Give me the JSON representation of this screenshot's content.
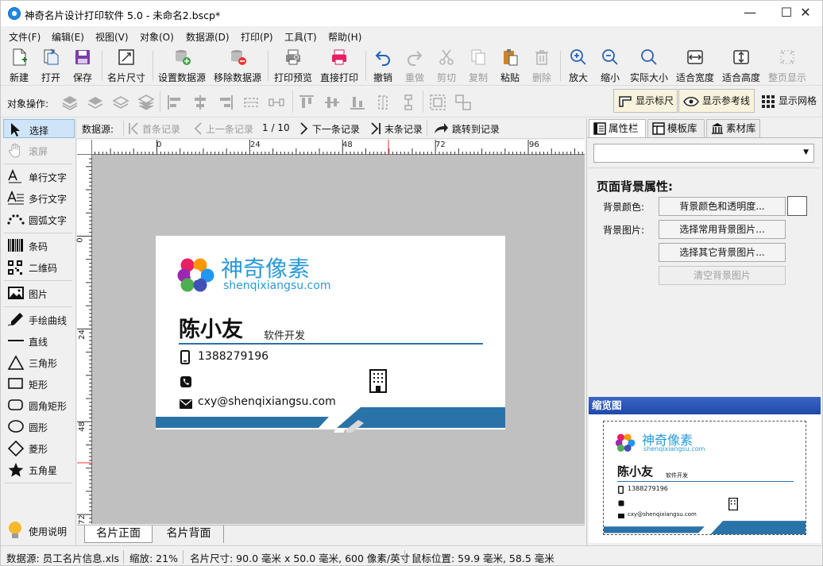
{
  "window": {
    "title": "神奇名片设计打印软件 5.0 - 未命名2.bscp*",
    "minimize_glyph": "—",
    "maximize_glyph": "☐",
    "close_glyph": "✕"
  },
  "menu": [
    "文件(F)",
    "编辑(E)",
    "视图(V)",
    "对象(O)",
    "数据源(D)",
    "打印(P)",
    "工具(T)",
    "帮助(H)"
  ],
  "toolbar": {
    "new": "新建",
    "open": "打开",
    "save": "保存",
    "card_size": "名片尺寸",
    "set_datasource": "设置数据源",
    "remove_datasource": "移除数据源",
    "print_preview": "打印预览",
    "direct_print": "直接打印",
    "undo": "撤销",
    "redo": "重做",
    "cut": "剪切",
    "copy": "复制",
    "paste": "粘贴",
    "delete": "删除",
    "zoom_in": "放大",
    "zoom_out": "缩小",
    "actual_size": "实际大小",
    "fit_width": "适合宽度",
    "fit_height": "适合高度",
    "whole_page": "整页显示"
  },
  "object_bar": {
    "label": "对象操作:",
    "show_ruler": "显示标尺",
    "show_guides": "显示参考线",
    "show_grid": "显示网格"
  },
  "tools": {
    "select": "选择",
    "pan": "滚屏",
    "single_text": "单行文字",
    "multi_text": "多行文字",
    "arc_text": "圆弧文字",
    "barcode": "条码",
    "qrcode": "二维码",
    "image": "图片",
    "freehand": "手绘曲线",
    "line": "直线",
    "triangle": "三角形",
    "rectangle": "矩形",
    "rounded_rect": "圆角矩形",
    "circle": "圆形",
    "diamond": "菱形",
    "star": "五角星",
    "help": "使用说明"
  },
  "datasource_nav": {
    "label": "数据源:",
    "first": "首条记录",
    "prev": "上一条记录",
    "position": "1 / 10",
    "next": "下一条记录",
    "last": "末条记录",
    "goto": "跳转到记录"
  },
  "rulers": {
    "h_ticks": [
      "0",
      "24",
      "48",
      "72",
      "96"
    ],
    "v_ticks": [
      "0",
      "24",
      "48",
      "72"
    ]
  },
  "card": {
    "brand_cn": "神奇像素",
    "brand_en": "shenqixiangsu.com",
    "name": "陈小友",
    "role": "软件开发",
    "phone": "1388279196",
    "email": "cxy@shenqixiangsu.com",
    "accent_color": "#2a73a8",
    "brand_color": "#2a9ad8"
  },
  "page_tabs": [
    "名片正面",
    "名片背面"
  ],
  "right_panel": {
    "tabs": [
      "属性栏",
      "模板库",
      "素材库"
    ],
    "section_title": "页面背景属性:",
    "bg_color_label": "背景颜色:",
    "bg_color_button": "背景颜色和透明度...",
    "bg_image_label": "背景图片:",
    "common_bg_button": "选择常用背景图片...",
    "other_bg_button": "选择其它背景图片...",
    "clear_bg_button": "清空背景图片",
    "thumbnail_title": "缩览图"
  },
  "status": {
    "datasource": "数据源: 员工名片信息.xls",
    "zoom": "缩放: 21%",
    "card_size": "名片尺寸: 90.0 毫米 x 50.0 毫米, 600 像素/英寸",
    "mouse_pos": "鼠标位置: 59.9 毫米, 58.5 毫米"
  }
}
